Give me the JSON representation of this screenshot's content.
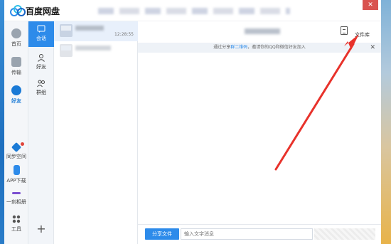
{
  "app": {
    "title": "百度网盘",
    "close_glyph": "✕"
  },
  "left_nav": [
    {
      "label": "首页",
      "icon": "cloud-icon"
    },
    {
      "label": "传输",
      "icon": "transfer-icon"
    },
    {
      "label": "好友",
      "icon": "friends-icon",
      "active": true
    },
    {
      "label": "同步空间",
      "icon": "sync-icon",
      "badge": true
    },
    {
      "label": "APP下载",
      "icon": "phone-icon"
    },
    {
      "label": "一刻相册",
      "icon": "album-icon"
    },
    {
      "label": "工具",
      "icon": "grid-icon"
    }
  ],
  "mid_nav": [
    {
      "label": "会话",
      "icon": "chat-icon",
      "active": true
    },
    {
      "label": "好友",
      "icon": "person-icon"
    },
    {
      "label": "群组",
      "icon": "group-icon"
    }
  ],
  "plus_label": "+",
  "conversations": [
    {
      "time": "12:28:55",
      "selected": true
    },
    {
      "time": "",
      "selected": false
    }
  ],
  "chat": {
    "library_label": "文件库",
    "notice_prefix": "通过分享",
    "notice_highlight": "群二维码",
    "notice_suffix": "，邀请你的QQ和微信好友加入",
    "notice_close": "✕",
    "share_button": "分享文件",
    "input_placeholder": "输入文字消息"
  },
  "colors": {
    "accent": "#2d8bea",
    "arrow": "#e8322b"
  }
}
